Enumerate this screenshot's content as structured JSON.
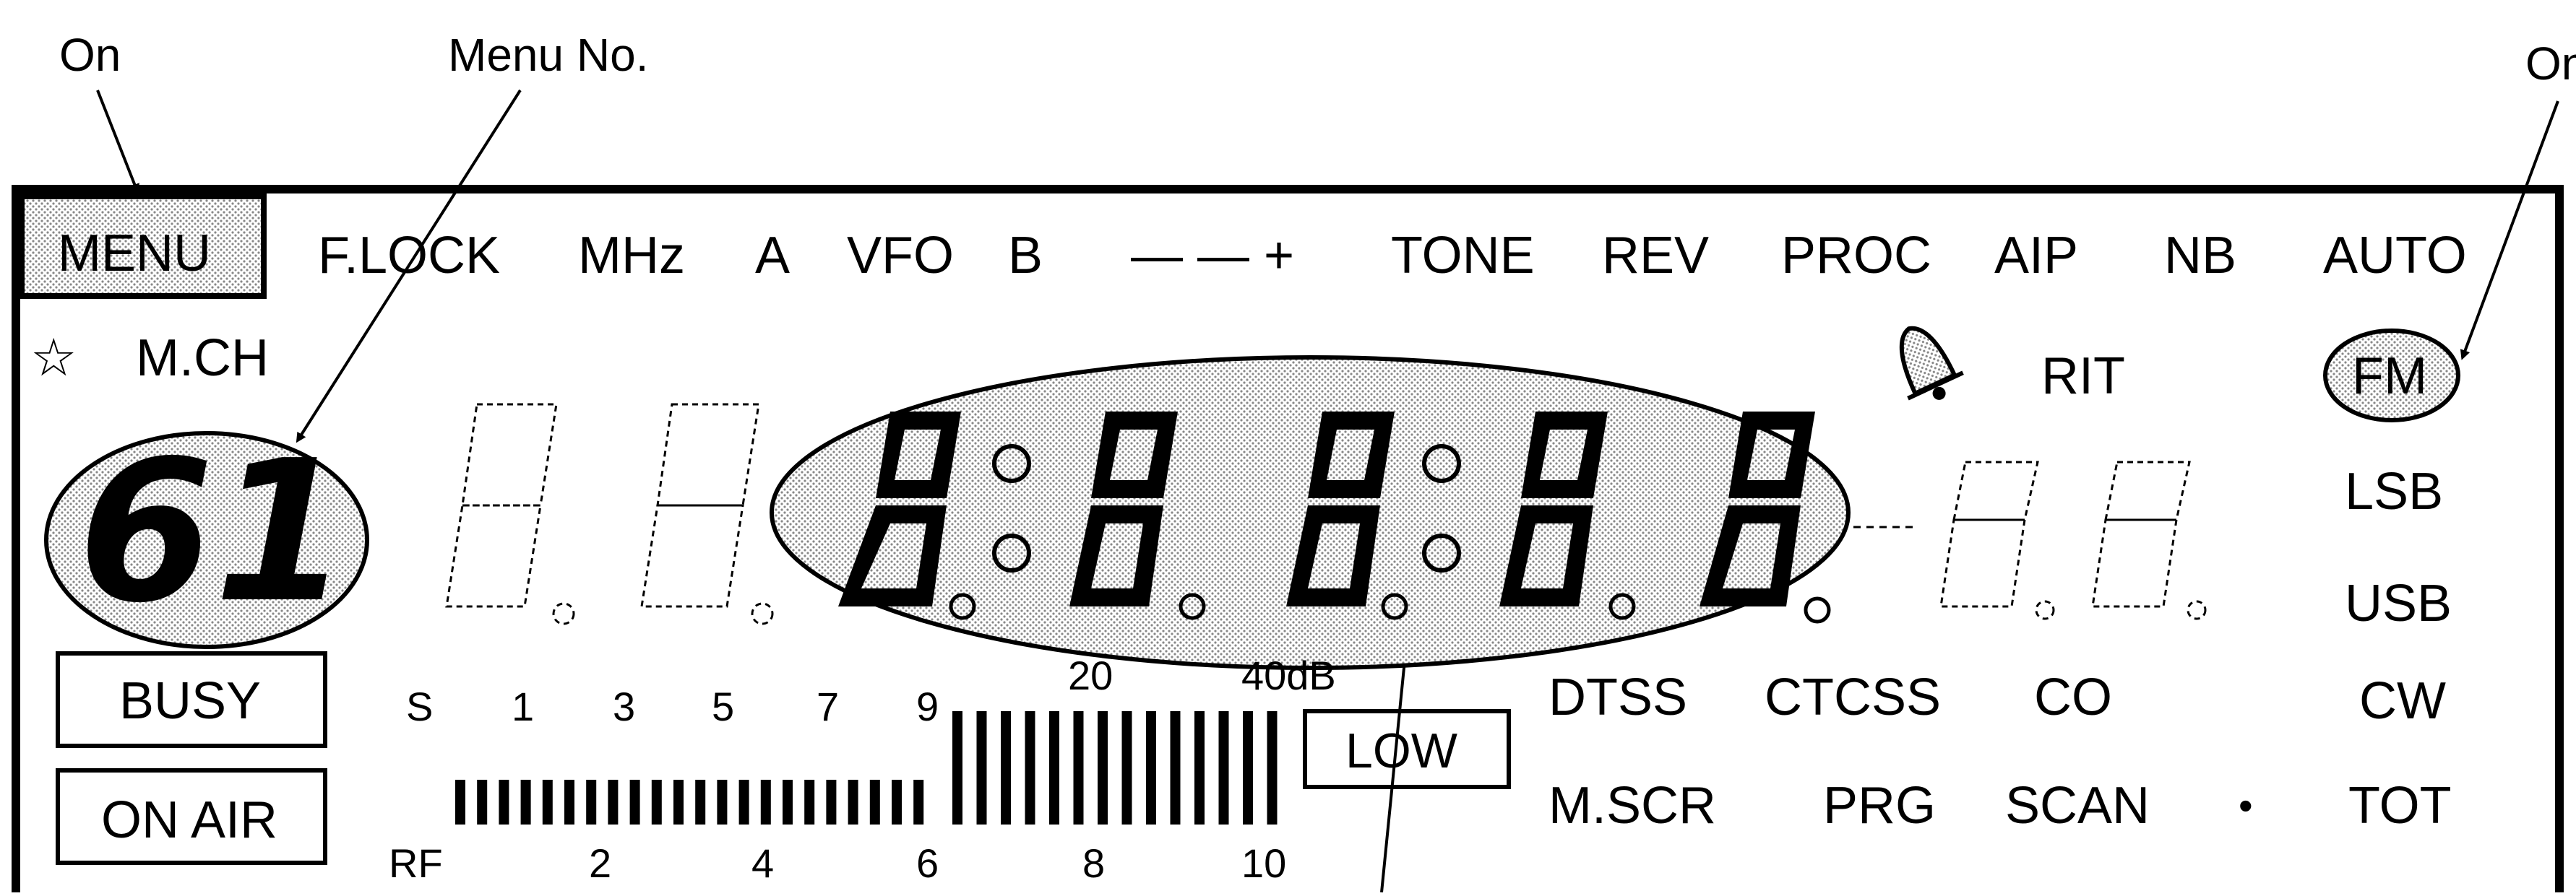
{
  "callouts": {
    "on_left": "On",
    "menu_no": "Menu No.",
    "on_right": "On"
  },
  "top_row": {
    "menu": "MENU",
    "flock": "F.LOCK",
    "mhz": "MHz",
    "a": "A",
    "vfo": "VFO",
    "b": "B",
    "minus_plus": "— — +",
    "tone": "TONE",
    "rev": "REV",
    "proc": "PROC",
    "aip": "AIP",
    "nb": "NB",
    "auto": "AUTO"
  },
  "second_row": {
    "star": "☆",
    "mch": "M.CH",
    "rit": "RIT",
    "fm": "FM"
  },
  "menu_number": "61",
  "right_modes": {
    "lsb": "LSB",
    "usb": "USB",
    "cw": "CW",
    "tot": "TOT"
  },
  "left_boxes": {
    "busy": "BUSY",
    "on_air": "ON AIR"
  },
  "s_meter": {
    "s_labels": [
      "S",
      "1",
      "3",
      "5",
      "7",
      "9"
    ],
    "db_labels": [
      "20",
      "40dB"
    ],
    "rf_labels": [
      "RF",
      "2",
      "4",
      "6",
      "8",
      "10"
    ]
  },
  "low": "LOW",
  "tone_modes": {
    "dtss": "DTSS",
    "ctcss": "CTCSS",
    "co": "CO",
    "mscr": "M.SCR",
    "prg": "PRG",
    "scan": "SCAN",
    "dot": "•"
  }
}
